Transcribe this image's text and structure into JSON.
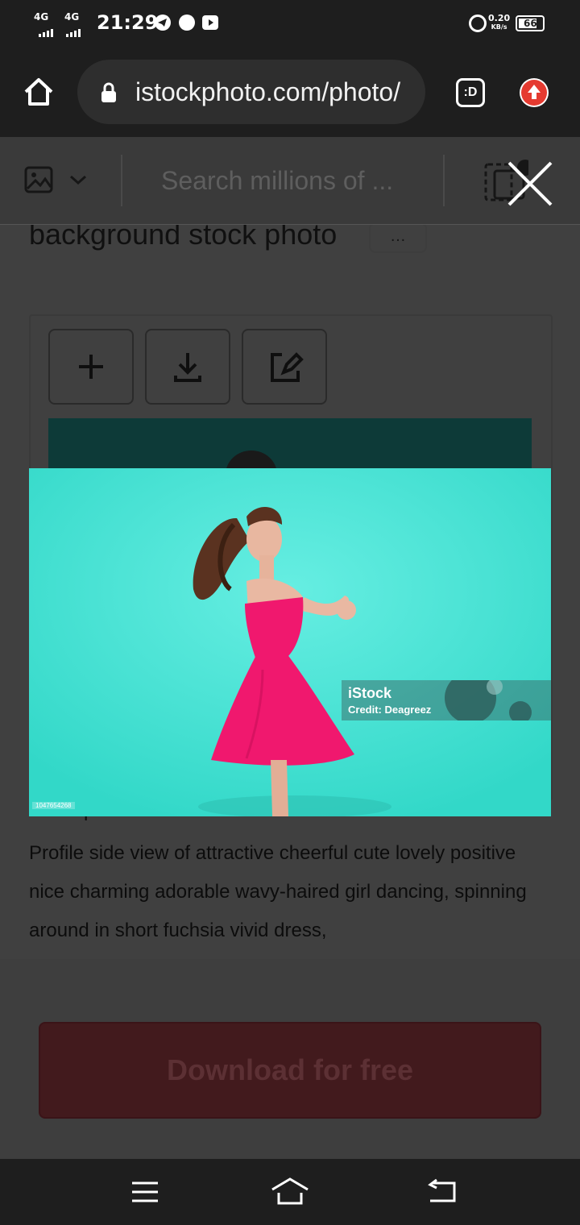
{
  "status_bar": {
    "network_1": "4G",
    "network_2": "4G",
    "time": "21:29",
    "speed_value": "0.20",
    "speed_unit": "KB/s",
    "battery": "66"
  },
  "browser": {
    "url": "istockphoto.com/photo/",
    "reader_label": ":D"
  },
  "search": {
    "placeholder": "Search millions of ..."
  },
  "page": {
    "title_fragment": "background stock photo",
    "more_label": "…",
    "description_heading": "Description",
    "description": "Profile side view of attractive cheerful cute lovely positive nice charming adorable wavy-haired girl dancing, spinning around in short fuchsia vivid dress,",
    "download_label": "Download for free"
  },
  "image_overlay": {
    "brand": "iStock",
    "credit": "Credit: Deagreez",
    "image_id": "1047654268"
  },
  "colors": {
    "photo_background": "#3fe0d0",
    "dress": "#f0186e",
    "download_button": "#421a1d"
  }
}
